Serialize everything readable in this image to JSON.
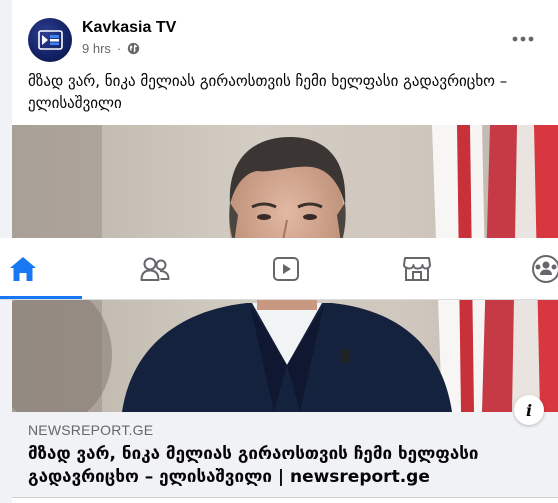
{
  "post": {
    "page_name": "Kavkasia TV",
    "time": "9 hrs",
    "separator": "·",
    "audience_icon": "globe-icon",
    "more_icon": "more-horizontal-icon",
    "text": "მზად ვარ, ნიკა მელიას გირაოსთვის ჩემი ხელფასი გადავრიცხო – ელისაშვილი"
  },
  "link_preview": {
    "domain": "NEWSREPORT.GE",
    "title": "მზად ვარ, ნიკა მელიას გირაოსთვის ჩემი ხელფასი გადავრიცხო – ელისაშვილი | newsreport.ge",
    "info_icon": "info-icon",
    "info_label": "i"
  },
  "tabbar": {
    "tabs": [
      {
        "name": "home",
        "icon": "home-icon",
        "active": true
      },
      {
        "name": "friends",
        "icon": "friends-icon",
        "active": false
      },
      {
        "name": "watch",
        "icon": "watch-icon",
        "active": false
      },
      {
        "name": "marketplace",
        "icon": "marketplace-icon",
        "active": false
      },
      {
        "name": "groups",
        "icon": "groups-icon",
        "active": false
      }
    ]
  },
  "colors": {
    "accent": "#1877f2",
    "inactive_icon": "#65676b",
    "secondary_text": "#65676b"
  }
}
